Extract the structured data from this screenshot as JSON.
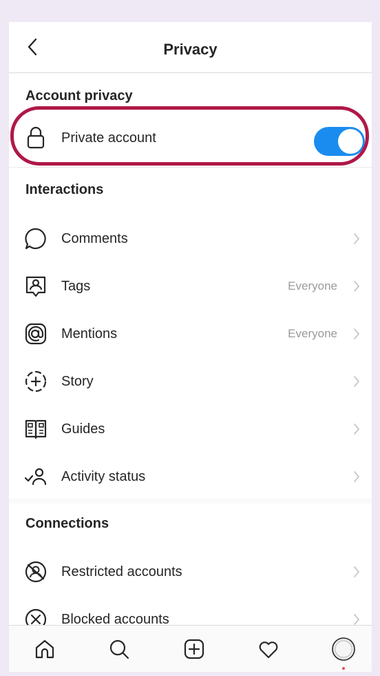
{
  "header": {
    "title": "Privacy"
  },
  "account_privacy": {
    "heading": "Account privacy",
    "private_label": "Private account",
    "private_enabled": true
  },
  "interactions": {
    "heading": "Interactions",
    "items": [
      {
        "label": "Comments",
        "value": "",
        "icon": "comment-icon"
      },
      {
        "label": "Tags",
        "value": "Everyone",
        "icon": "tag-icon"
      },
      {
        "label": "Mentions",
        "value": "Everyone",
        "icon": "mention-icon"
      },
      {
        "label": "Story",
        "value": "",
        "icon": "story-icon"
      },
      {
        "label": "Guides",
        "value": "",
        "icon": "guides-icon"
      },
      {
        "label": "Activity status",
        "value": "",
        "icon": "activity-status-icon"
      }
    ]
  },
  "connections": {
    "heading": "Connections",
    "items": [
      {
        "label": "Restricted accounts",
        "icon": "restricted-icon"
      },
      {
        "label": "Blocked accounts",
        "icon": "blocked-icon"
      }
    ]
  },
  "tabbar": {
    "icons": [
      "home-icon",
      "search-icon",
      "new-post-icon",
      "activity-heart-icon",
      "profile-avatar"
    ]
  },
  "colors": {
    "accent": "#1a8cf0",
    "highlight": "#b01848",
    "background": "#efe8f5"
  }
}
